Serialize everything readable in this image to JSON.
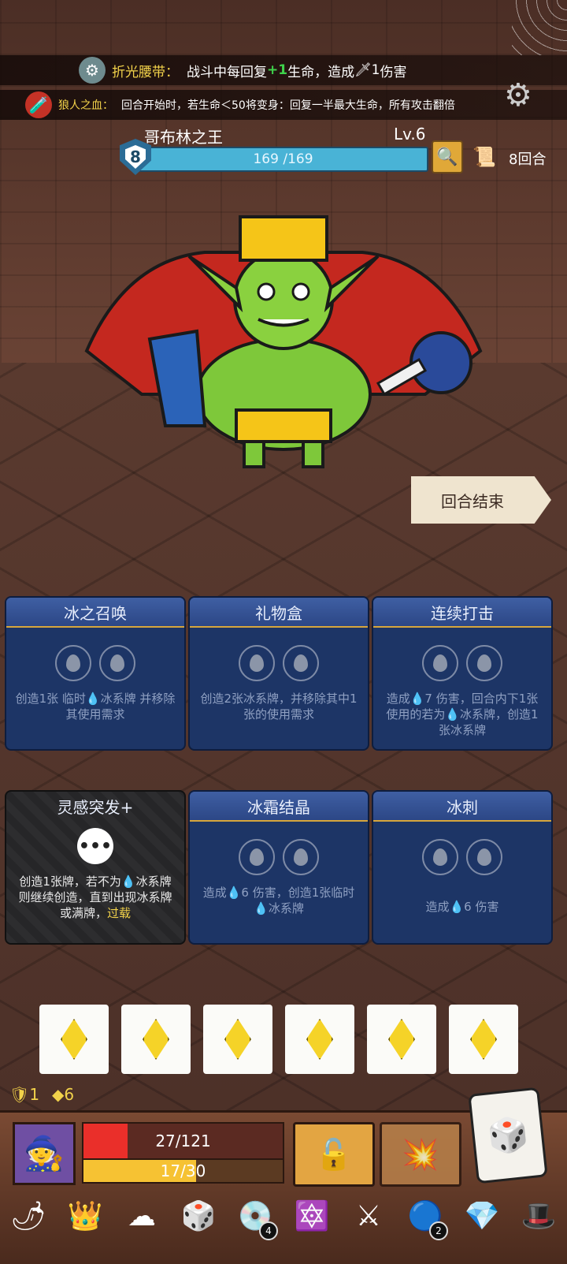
{
  "relics_top": [
    {
      "icon": "gear-belt-icon",
      "name": "折光腰带：",
      "text_a": "战斗中每回复",
      "plus": "+1",
      "text_b": " 生命，造成 ",
      "damage": "1",
      "text_c": " 伤害"
    },
    {
      "icon": "blood-bottle-icon",
      "name": "狼人之血：",
      "text": "回合开始时，若生命＜50将变身：回复一半最大生命，所有攻击翻倍"
    }
  ],
  "boss": {
    "name": "哥布林之王",
    "level": "Lv.6",
    "shield": "8",
    "hp_text": "169 /169",
    "hp_fraction": 1.0
  },
  "turn": {
    "count_text": "8回合"
  },
  "end_turn_label": "回合结束",
  "cards": [
    {
      "title": "冰之召唤",
      "desc": "创造1张 临时💧冰系牌 并移除其使用需求",
      "type": "ice"
    },
    {
      "title": "礼物盒",
      "desc": "创造2张冰系牌，并移除其中1张的使用需求",
      "type": "ice"
    },
    {
      "title": "连续打击",
      "desc": "造成💧7 伤害，回合内下1张使用的若为💧冰系牌，创造1张冰系牌",
      "type": "ice"
    },
    {
      "title": "灵感突发+",
      "desc_a": "创造1张牌，若不为💧冰系牌则继续创造，直到出现冰系牌或满牌，",
      "desc_b": "过载",
      "type": "dark"
    },
    {
      "title": "冰霜结晶",
      "desc": "造成💧6 伤害，创造1张临时💧冰系牌",
      "type": "ice"
    },
    {
      "title": "冰刺",
      "desc": "造成💧6 伤害",
      "type": "ice"
    }
  ],
  "mana_slots": 6,
  "stats": {
    "armor": "1",
    "energy": "6"
  },
  "player": {
    "hp_text": "27/121",
    "hp_fraction": 0.223,
    "xp_text": "17/30",
    "xp_fraction": 0.567
  },
  "bottom_relics": [
    {
      "icon": "pepper-icon"
    },
    {
      "icon": "crown-icon"
    },
    {
      "icon": "cloud-shell-icon"
    },
    {
      "icon": "spiked-dice-icon"
    },
    {
      "icon": "disc-icon",
      "badge": "4"
    },
    {
      "icon": "star-triangle-icon"
    },
    {
      "icon": "sword-shield-icon"
    },
    {
      "icon": "blue-orb-icon",
      "badge": "2"
    },
    {
      "icon": "red-gem-icon"
    },
    {
      "icon": "top-hat-icon"
    }
  ]
}
